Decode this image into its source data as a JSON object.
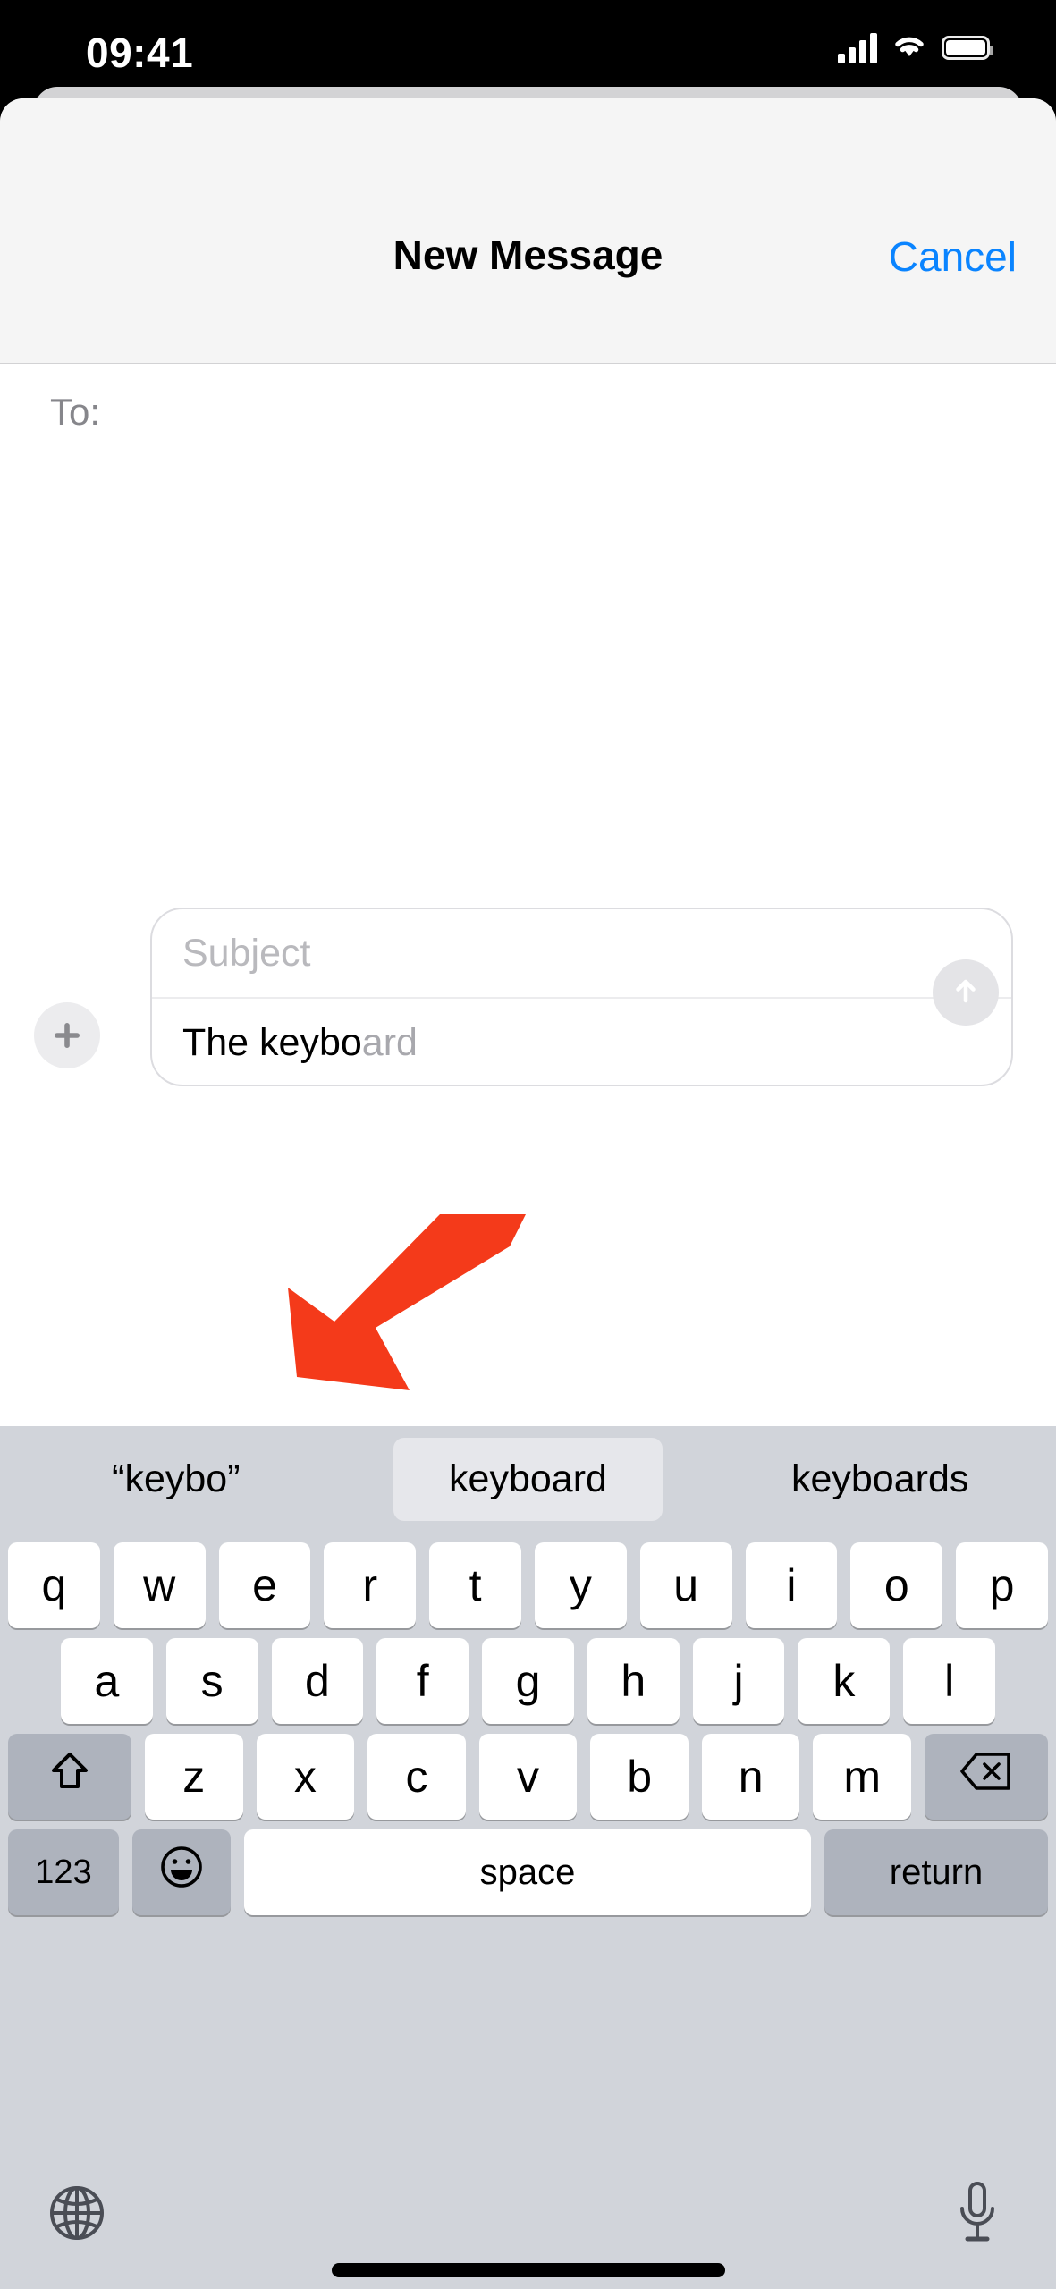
{
  "status_bar": {
    "time": "09:41",
    "cellular_icon": "signal-bars-icon",
    "wifi_icon": "wifi-icon",
    "battery_icon": "battery-icon"
  },
  "nav_bar": {
    "title": "New Message",
    "cancel_label": "Cancel"
  },
  "recipient_field": {
    "label": "To:",
    "value": ""
  },
  "compose": {
    "subject_placeholder": "Subject",
    "message_typed": "The keybo",
    "message_prediction": "ard",
    "plus_icon": "plus-icon",
    "send_icon": "send-arrow-up-icon"
  },
  "keyboard": {
    "predictions": [
      {
        "label": "“keybo”",
        "selected": false
      },
      {
        "label": "keyboard",
        "selected": true
      },
      {
        "label": "keyboards",
        "selected": false
      }
    ],
    "row1": [
      "q",
      "w",
      "e",
      "r",
      "t",
      "y",
      "u",
      "i",
      "o",
      "p"
    ],
    "row2": [
      "a",
      "s",
      "d",
      "f",
      "g",
      "h",
      "j",
      "k",
      "l"
    ],
    "row3": [
      "z",
      "x",
      "c",
      "v",
      "b",
      "n",
      "m"
    ],
    "shift_icon": "shift-up-arrow-icon",
    "delete_icon": "backspace-delete-icon",
    "numbers_label": "123",
    "emoji_icon": "emoji-smiley-icon",
    "space_label": "space",
    "return_label": "return",
    "globe_icon": "globe-language-icon",
    "mic_icon": "microphone-dictation-icon"
  },
  "annotation": {
    "arrow_icon": "red-pointer-arrow-icon",
    "arrow_color": "#F43A1A"
  },
  "colors": {
    "accent_blue": "#0A84FF",
    "keyboard_background": "#D1D4DA",
    "key_white": "#FFFFFF",
    "key_dark": "#AEB3BD",
    "nav_background": "#F5F5F5",
    "placeholder_gray": "#B9B9BD",
    "prediction_gray": "#A8A8AD"
  }
}
